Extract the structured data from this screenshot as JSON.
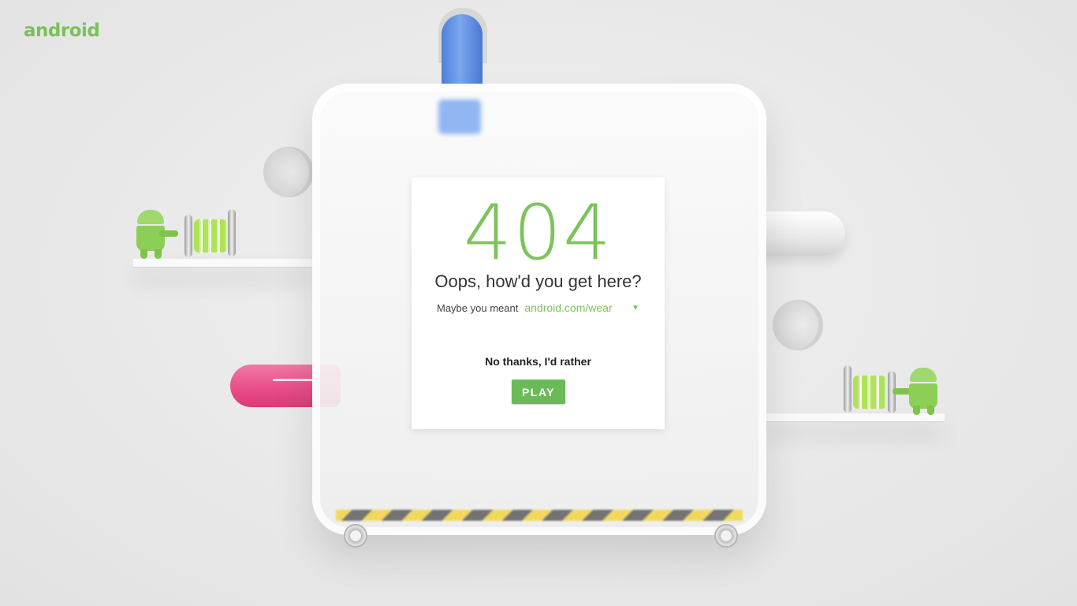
{
  "brand": {
    "logo_text": "android",
    "accent_color": "#78c257"
  },
  "error": {
    "code": "404",
    "headline": "Oops, how'd you get here?",
    "suggestion_label": "Maybe you meant",
    "suggestion_selected": "android.com/wear",
    "suggestion_caret_icon": "triangle-down-icon",
    "alternative_text": "No thanks, I'd rather",
    "play_button_label": "PLAY",
    "button_color": "#6aba58"
  },
  "scene": {
    "pipe_colors": {
      "blue": "#5b8be0",
      "pink": "#e94e8a",
      "white": "#f5f5f5"
    },
    "robot_color": "#8bcf57",
    "spring_color": "#aee25a"
  }
}
